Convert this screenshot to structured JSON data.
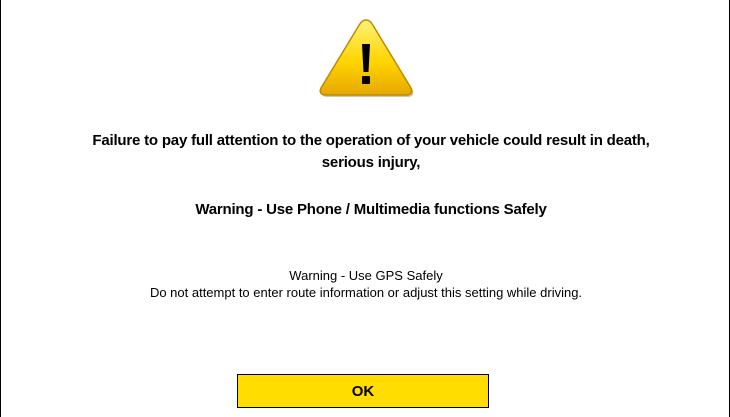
{
  "dialog": {
    "icon": "warning-triangle-icon",
    "headline_line1": "Failure to pay full attention to the operation of your vehicle could result in death,",
    "headline_line2": "serious injury,",
    "phone_warning": "Warning - Use Phone / Multimedia functions Safely",
    "gps_warning_title": "Warning - Use GPS Safely",
    "gps_warning_text": "Do not attempt to enter route information or adjust this setting while driving.",
    "ok_label": "OK"
  },
  "colors": {
    "button_bg": "#ffdd00",
    "icon_fill": "#ffd700",
    "text": "#000000",
    "background": "#ffffff"
  }
}
